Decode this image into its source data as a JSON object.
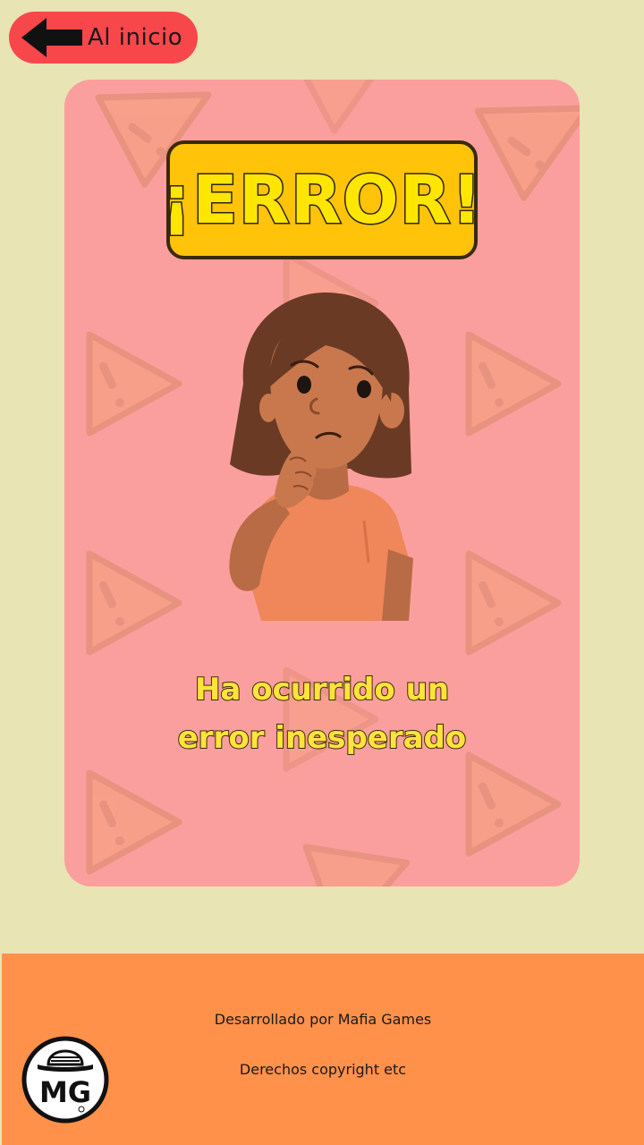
{
  "nav": {
    "back_label": "Al inicio"
  },
  "error_card": {
    "title": "¡ERROR!",
    "message_line1": "Ha ocurrido un",
    "message_line2": "error inesperado"
  },
  "footer": {
    "developer": "Desarrollado por Mafia Games",
    "copyright": "Derechos copyright etc",
    "logo_text": "MG"
  },
  "icons": {
    "back": "arrow-left-icon",
    "warning": "warning-triangle-icon",
    "logo": "mafia-games-logo"
  },
  "colors": {
    "background": "#e8e4b4",
    "back_button": "#f8474b",
    "card": "#fb9f9e",
    "title_box": "#ffc30a",
    "title_text": "#ffe600",
    "message_text": "#ffe33b",
    "footer": "#ff914b"
  }
}
